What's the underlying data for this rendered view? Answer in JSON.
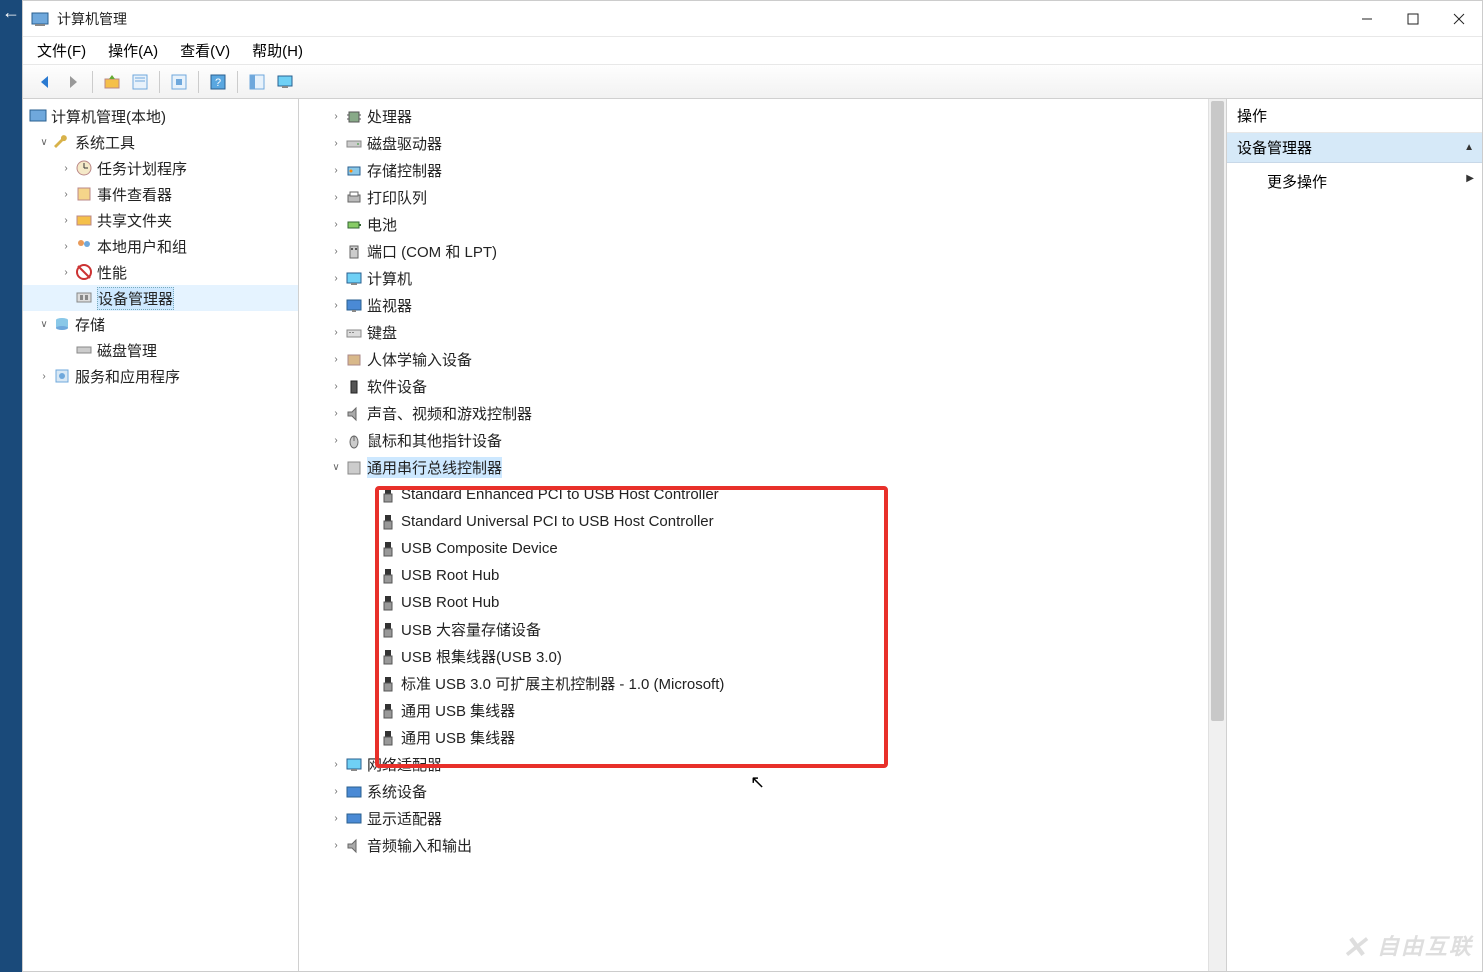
{
  "window": {
    "title": "计算机管理"
  },
  "menu": {
    "file": "文件(F)",
    "action": "操作(A)",
    "view": "查看(V)",
    "help": "帮助(H)"
  },
  "left_tree": {
    "root": "计算机管理(本地)",
    "system_tools": "系统工具",
    "task_scheduler": "任务计划程序",
    "event_viewer": "事件查看器",
    "shared_folders": "共享文件夹",
    "local_users": "本地用户和组",
    "performance": "性能",
    "device_manager": "设备管理器",
    "storage": "存储",
    "disk_management": "磁盘管理",
    "services_apps": "服务和应用程序"
  },
  "devices": {
    "processor": "处理器",
    "disk_drives": "磁盘驱动器",
    "storage_ctrl": "存储控制器",
    "print_queue": "打印队列",
    "battery": "电池",
    "ports": "端口 (COM 和 LPT)",
    "computer": "计算机",
    "monitor": "监视器",
    "keyboard": "键盘",
    "hid": "人体学输入设备",
    "software_dev": "软件设备",
    "sound": "声音、视频和游戏控制器",
    "mouse": "鼠标和其他指针设备",
    "usb_ctrl": "通用串行总线控制器",
    "usb_items": [
      "Standard Enhanced PCI to USB Host Controller",
      "Standard Universal PCI to USB Host Controller",
      "USB Composite Device",
      "USB Root Hub",
      "USB Root Hub",
      "USB 大容量存储设备",
      "USB 根集线器(USB 3.0)",
      "标准 USB 3.0 可扩展主机控制器 - 1.0 (Microsoft)",
      "通用 USB 集线器",
      "通用 USB 集线器"
    ],
    "network": "网络适配器",
    "system_dev": "系统设备",
    "display": "显示适配器",
    "audio_io": "音频输入和输出"
  },
  "actions_panel": {
    "header": "操作",
    "sub": "设备管理器",
    "more": "更多操作"
  },
  "watermark": "自由互联"
}
